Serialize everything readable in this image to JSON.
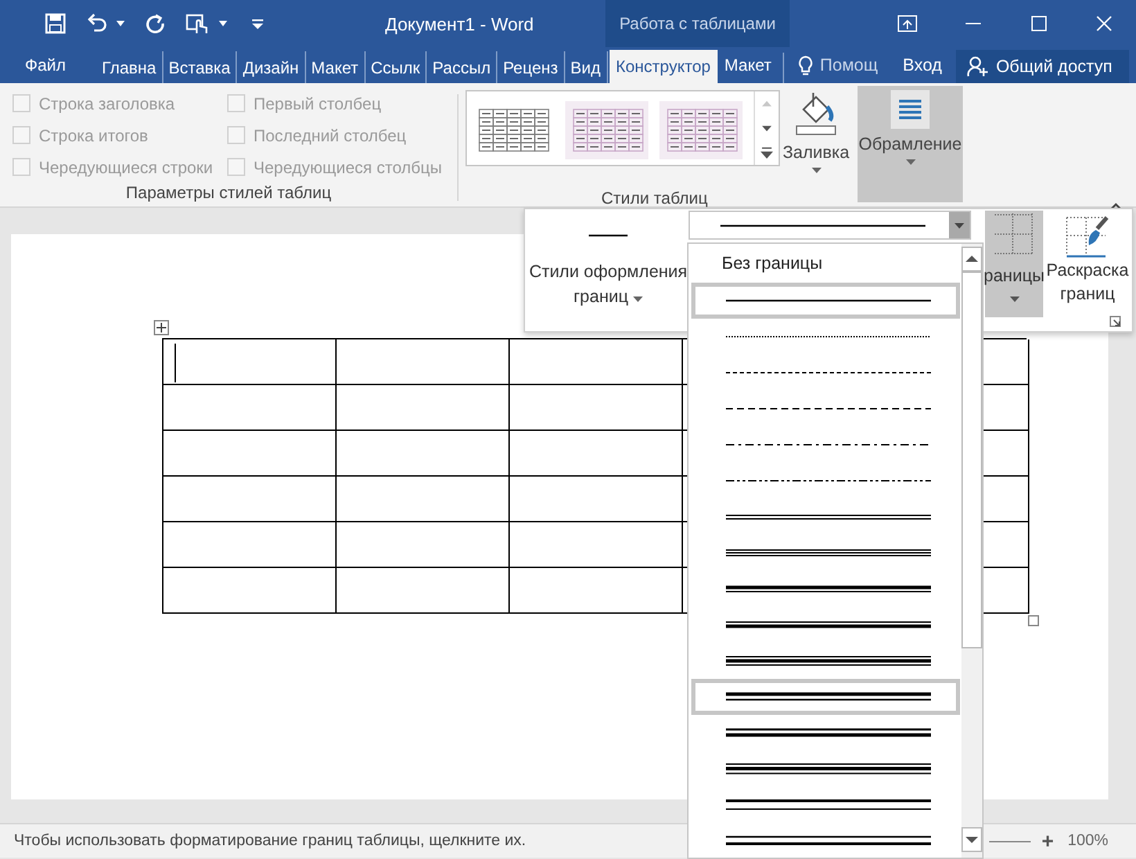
{
  "title_bar": {
    "title": "Документ1 - Word",
    "context_tab": "Работа с таблицами"
  },
  "tabs": [
    {
      "label": "Файл",
      "selected": false
    },
    {
      "label": "Главна",
      "selected": false
    },
    {
      "label": "Вставка",
      "selected": false
    },
    {
      "label": "Дизайн",
      "selected": false
    },
    {
      "label": "Макет",
      "selected": false
    },
    {
      "label": "Ссылк",
      "selected": false
    },
    {
      "label": "Рассыл",
      "selected": false
    },
    {
      "label": "Реценз",
      "selected": false
    },
    {
      "label": "Вид",
      "selected": false
    },
    {
      "label": "Конструктор",
      "selected": true
    },
    {
      "label": "Макет",
      "selected": false
    }
  ],
  "tell_me": "Помощ",
  "sign_in": "Вход",
  "share": "Общий доступ",
  "style_options": {
    "title": "Параметры стилей таблиц",
    "options": [
      {
        "label": "Строка заголовка",
        "checked": false,
        "disabled": true
      },
      {
        "label": "Строка итогов",
        "checked": false,
        "disabled": true
      },
      {
        "label": "Чередующиеся строки",
        "checked": false,
        "disabled": true
      },
      {
        "label": "Первый столбец",
        "checked": false,
        "disabled": true
      },
      {
        "label": "Последний столбец",
        "checked": false,
        "disabled": true
      },
      {
        "label": "Чередующиеся столбцы",
        "checked": false,
        "disabled": true
      }
    ]
  },
  "table_styles": {
    "title": "Стили таблиц",
    "gallery": [
      {
        "color": "#7f7f7f"
      },
      {
        "color": "#c7a7c7"
      },
      {
        "color": "#c7a7c7"
      }
    ],
    "shading": "Заливка",
    "borders": {
      "label": "Обрамление",
      "selected": true
    }
  },
  "border_flyout": {
    "border_styles": "Стили оформления границ",
    "current_line": {
      "kind": "single"
    },
    "borders_button": "раницы",
    "border_painter": "Раскраска границ"
  },
  "line_style_menu": {
    "items": [
      {
        "kind": "text",
        "label": "Без границы",
        "selected": false
      },
      {
        "kind": "single",
        "selected": true
      },
      {
        "kind": "dotted",
        "selected": false
      },
      {
        "kind": "dashed",
        "selected": false
      },
      {
        "kind": "long-dashed",
        "selected": false
      },
      {
        "kind": "dash-dot",
        "selected": false
      },
      {
        "kind": "dash-dot-dot",
        "selected": false
      },
      {
        "kind": "double",
        "selected": false
      },
      {
        "kind": "triple",
        "selected": false
      },
      {
        "kind": "thick-thin",
        "selected": false
      },
      {
        "kind": "thin-thick",
        "selected": false
      },
      {
        "kind": "thin-thick-thin",
        "selected": false
      },
      {
        "kind": "thick-thin-medium",
        "selected": true
      },
      {
        "kind": "thin-thick-medium",
        "selected": false
      },
      {
        "kind": "thin-thick-thin-medium",
        "selected": false
      },
      {
        "kind": "thick-thin-large",
        "selected": false
      },
      {
        "kind": "thin-thick-large",
        "selected": false
      }
    ]
  },
  "status_bar": {
    "message": "Чтобы использовать форматирование границ таблицы, щелкните их.",
    "zoom_in": "+",
    "zoom": "100%"
  }
}
